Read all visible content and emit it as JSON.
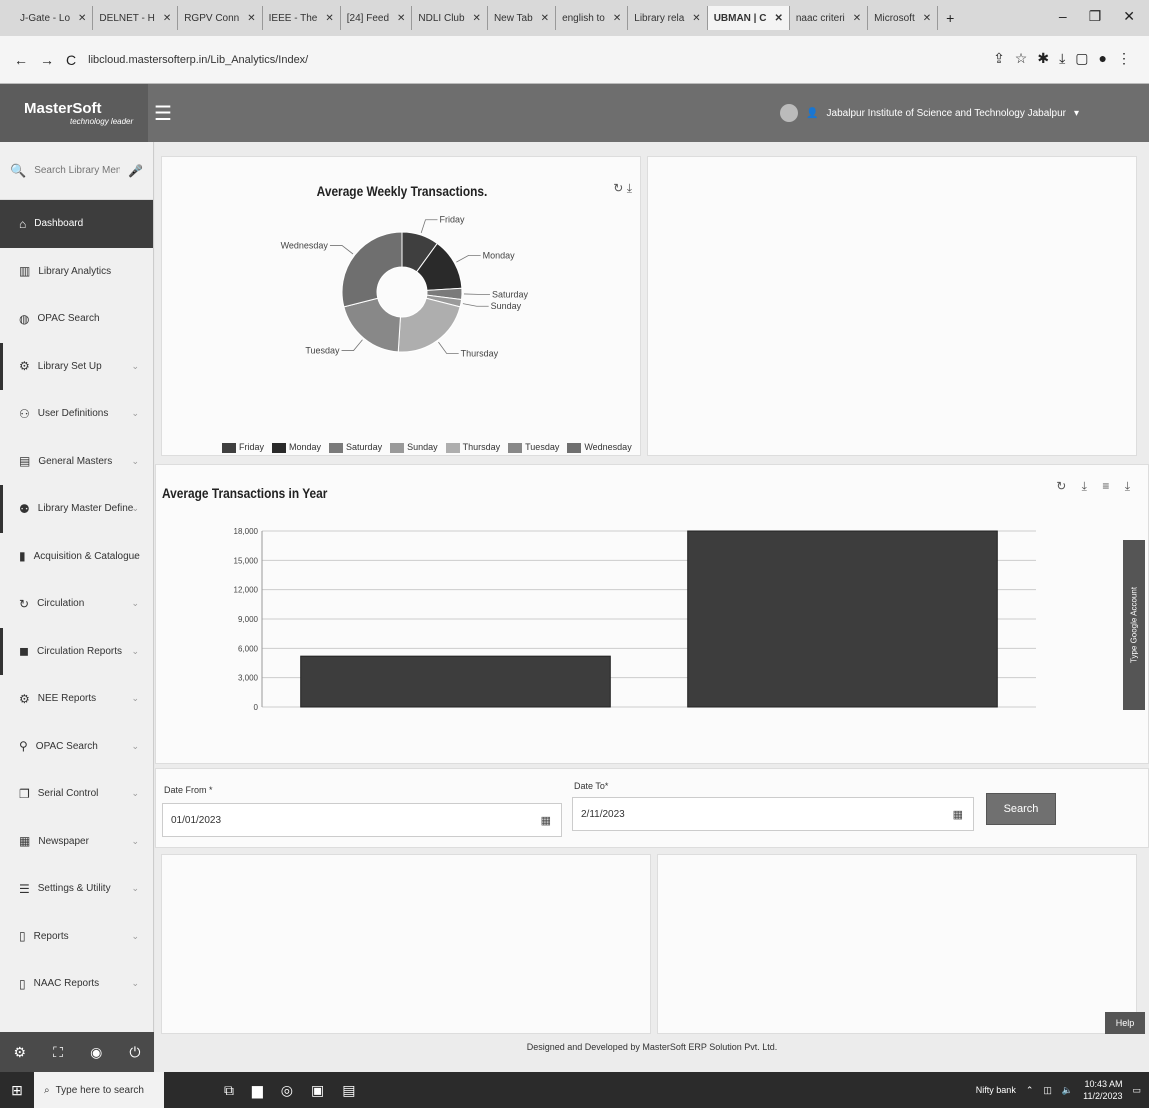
{
  "browser": {
    "tabs": [
      "J-Gate - Lo",
      "DELNET - H",
      "RGPV Conn",
      "IEEE - The",
      "[24] Feed",
      "NDLI Club",
      "New Tab",
      "english to",
      "Library rela",
      "UBMAN | C",
      "naac criteri",
      "Microsoft"
    ],
    "active_tab_index": 9,
    "url": "libcloud.mastersofterp.in/Lib_Analytics/Index/"
  },
  "header": {
    "brand": "MasterSoft",
    "tagline": "technology leader",
    "institute": "Jabalpur Institute of Science and Technology Jabalpur"
  },
  "sidebar": {
    "search_placeholder": "Search Library Menu",
    "items": [
      {
        "label": "Dashboard",
        "icon": "home-icon"
      },
      {
        "label": "Library Analytics",
        "icon": "chart-icon"
      },
      {
        "label": "OPAC Search",
        "icon": "globe-icon"
      },
      {
        "label": "Library Set Up",
        "icon": "gear-icon"
      },
      {
        "label": "User Definitions",
        "icon": "users-icon"
      },
      {
        "label": "General Masters",
        "icon": "doc-icon"
      },
      {
        "label": "Library Master Define",
        "icon": "group-icon"
      },
      {
        "label": "Acquisition & Catalogue",
        "icon": "book-icon"
      },
      {
        "label": "Circulation",
        "icon": "refresh-icon"
      },
      {
        "label": "Circulation Reports",
        "icon": "truck-icon"
      },
      {
        "label": "NEE Reports",
        "icon": "settings-icon"
      },
      {
        "label": "OPAC Search",
        "icon": "search-icon"
      },
      {
        "label": "Serial Control",
        "icon": "copy-icon"
      },
      {
        "label": "Newspaper",
        "icon": "newspaper-icon"
      },
      {
        "label": "Settings & Utility",
        "icon": "sliders-icon"
      },
      {
        "label": "Reports",
        "icon": "file-icon"
      },
      {
        "label": "NAAC Reports",
        "icon": "file-icon"
      }
    ]
  },
  "weekly": {
    "title": "Average Weekly Transactions.",
    "chart_data": {
      "type": "pie",
      "title": "Average Weekly Transactions.",
      "labels": [
        "Friday",
        "Monday",
        "Saturday",
        "Sunday",
        "Thursday",
        "Tuesday",
        "Wednesday"
      ],
      "values": [
        10,
        14,
        3,
        2,
        22,
        20,
        29
      ],
      "colors": [
        "#3f3f3f",
        "#2a2a2a",
        "#7a7a7a",
        "#9a9a9a",
        "#aeaeae",
        "#888888",
        "#6f6f6f"
      ],
      "legend": "bottom"
    }
  },
  "yearly": {
    "title": "Average Transactions in Year",
    "chart_data": {
      "type": "bar",
      "title": "Average Transactions in Year",
      "categories": [
        "",
        ""
      ],
      "values": [
        5200,
        18000
      ],
      "yticks": [
        "0",
        "3,000",
        "6,000",
        "9,000",
        "12,000",
        "15,000",
        "18,000"
      ],
      "ylim": [
        0,
        18000
      ],
      "grid": true,
      "color": "#3d3d3d"
    }
  },
  "form": {
    "date_from_label": "Date From *",
    "date_from_value": "01/01/2023",
    "date_to_label": "Date To*",
    "date_to_value": "2/11/2023",
    "search_label": "Search"
  },
  "side_tab": "Type Google Account",
  "help": "Help",
  "footer": "Designed and Developed by MasterSoft ERP Solution Pvt. Ltd.",
  "taskbar": {
    "search_placeholder": "Type here to search",
    "tray_text": "Nifty bank",
    "time": "10:43 AM",
    "date": "11/2/2023"
  }
}
